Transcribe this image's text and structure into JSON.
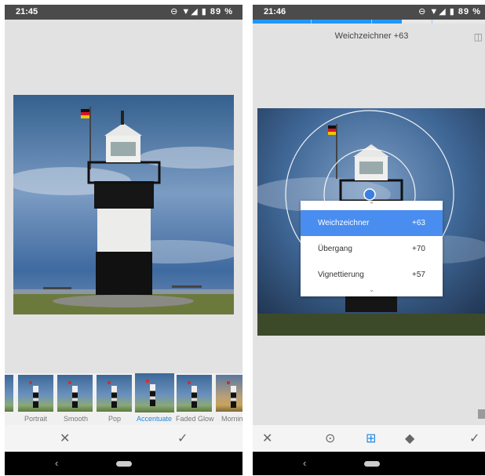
{
  "left_screen": {
    "status": {
      "time": "21:45",
      "icons": "⊖ ▼◢ ▮",
      "battery": "89 %"
    },
    "filters": [
      {
        "label": "l",
        "selected": false
      },
      {
        "label": "Portrait",
        "selected": false
      },
      {
        "label": "Smooth",
        "selected": false
      },
      {
        "label": "Pop",
        "selected": false
      },
      {
        "label": "Accentuate",
        "selected": true
      },
      {
        "label": "Faded Glow",
        "selected": false
      },
      {
        "label": "Mornin",
        "selected": false
      }
    ],
    "toolbar": {
      "cancel": "✕",
      "apply": "✓"
    },
    "nav": {
      "back": "‹"
    }
  },
  "right_screen": {
    "status": {
      "time": "21:46",
      "icons": "⊖ ▼◢ ▮",
      "battery": "89 %"
    },
    "edit_label": "Weichzeichner +63",
    "compare_icon": "◫",
    "menu": {
      "up": "⌃",
      "down": "⌄",
      "items": [
        {
          "name": "Weichzeichner",
          "value": "+63",
          "active": true
        },
        {
          "name": "Übergang",
          "value": "+70",
          "active": false
        },
        {
          "name": "Vignettierung",
          "value": "+57",
          "active": false
        }
      ]
    },
    "tools": {
      "cancel": "✕",
      "point": "⊙",
      "adjust": "⊞",
      "styles": "◆",
      "apply": "✓"
    },
    "nav": {
      "back": "‹"
    }
  },
  "colors": {
    "accent": "#1e88e5",
    "menu_active": "#4a8df0",
    "statusbar": "#4b4b4b"
  }
}
